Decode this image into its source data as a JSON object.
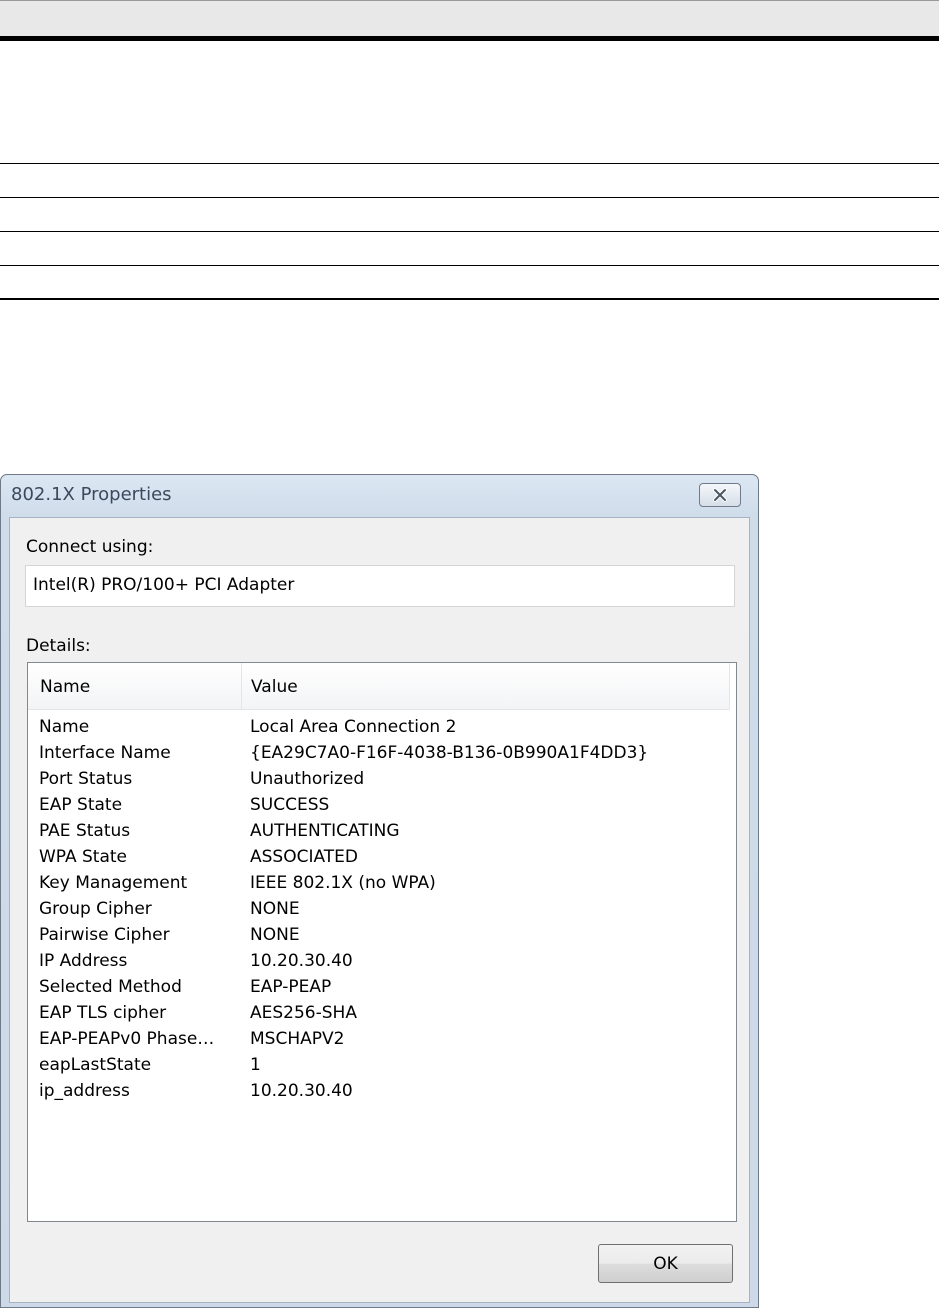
{
  "window": {
    "title": "802.1X Properties"
  },
  "connect_using": {
    "label": "Connect using:",
    "adapter": "Intel(R) PRO/100+ PCI Adapter"
  },
  "details": {
    "label": "Details:",
    "columns": [
      "Name",
      "Value"
    ],
    "rows": [
      {
        "name": "Name",
        "value": "Local Area Connection 2"
      },
      {
        "name": "Interface Name",
        "value": "{EA29C7A0-F16F-4038-B136-0B990A1F4DD3}"
      },
      {
        "name": "Port Status",
        "value": "Unauthorized"
      },
      {
        "name": "EAP State",
        "value": "SUCCESS"
      },
      {
        "name": "PAE Status",
        "value": "AUTHENTICATING"
      },
      {
        "name": "WPA State",
        "value": "ASSOCIATED"
      },
      {
        "name": "Key Management",
        "value": "IEEE 802.1X (no WPA)"
      },
      {
        "name": "Group Cipher",
        "value": "NONE"
      },
      {
        "name": "Pairwise Cipher",
        "value": "NONE"
      },
      {
        "name": "IP Address",
        "value": "10.20.30.40"
      },
      {
        "name": "Selected Method",
        "value": "EAP-PEAP"
      },
      {
        "name": "EAP TLS cipher",
        "value": "AES256-SHA"
      },
      {
        "name": "EAP-PEAPv0 Phase…",
        "value": "MSCHAPV2"
      },
      {
        "name": "eapLastState",
        "value": "1"
      },
      {
        "name": "ip_address",
        "value": "10.20.30.40"
      }
    ]
  },
  "buttons": {
    "ok_label": "OK"
  },
  "icons": {
    "close": "close-icon"
  }
}
